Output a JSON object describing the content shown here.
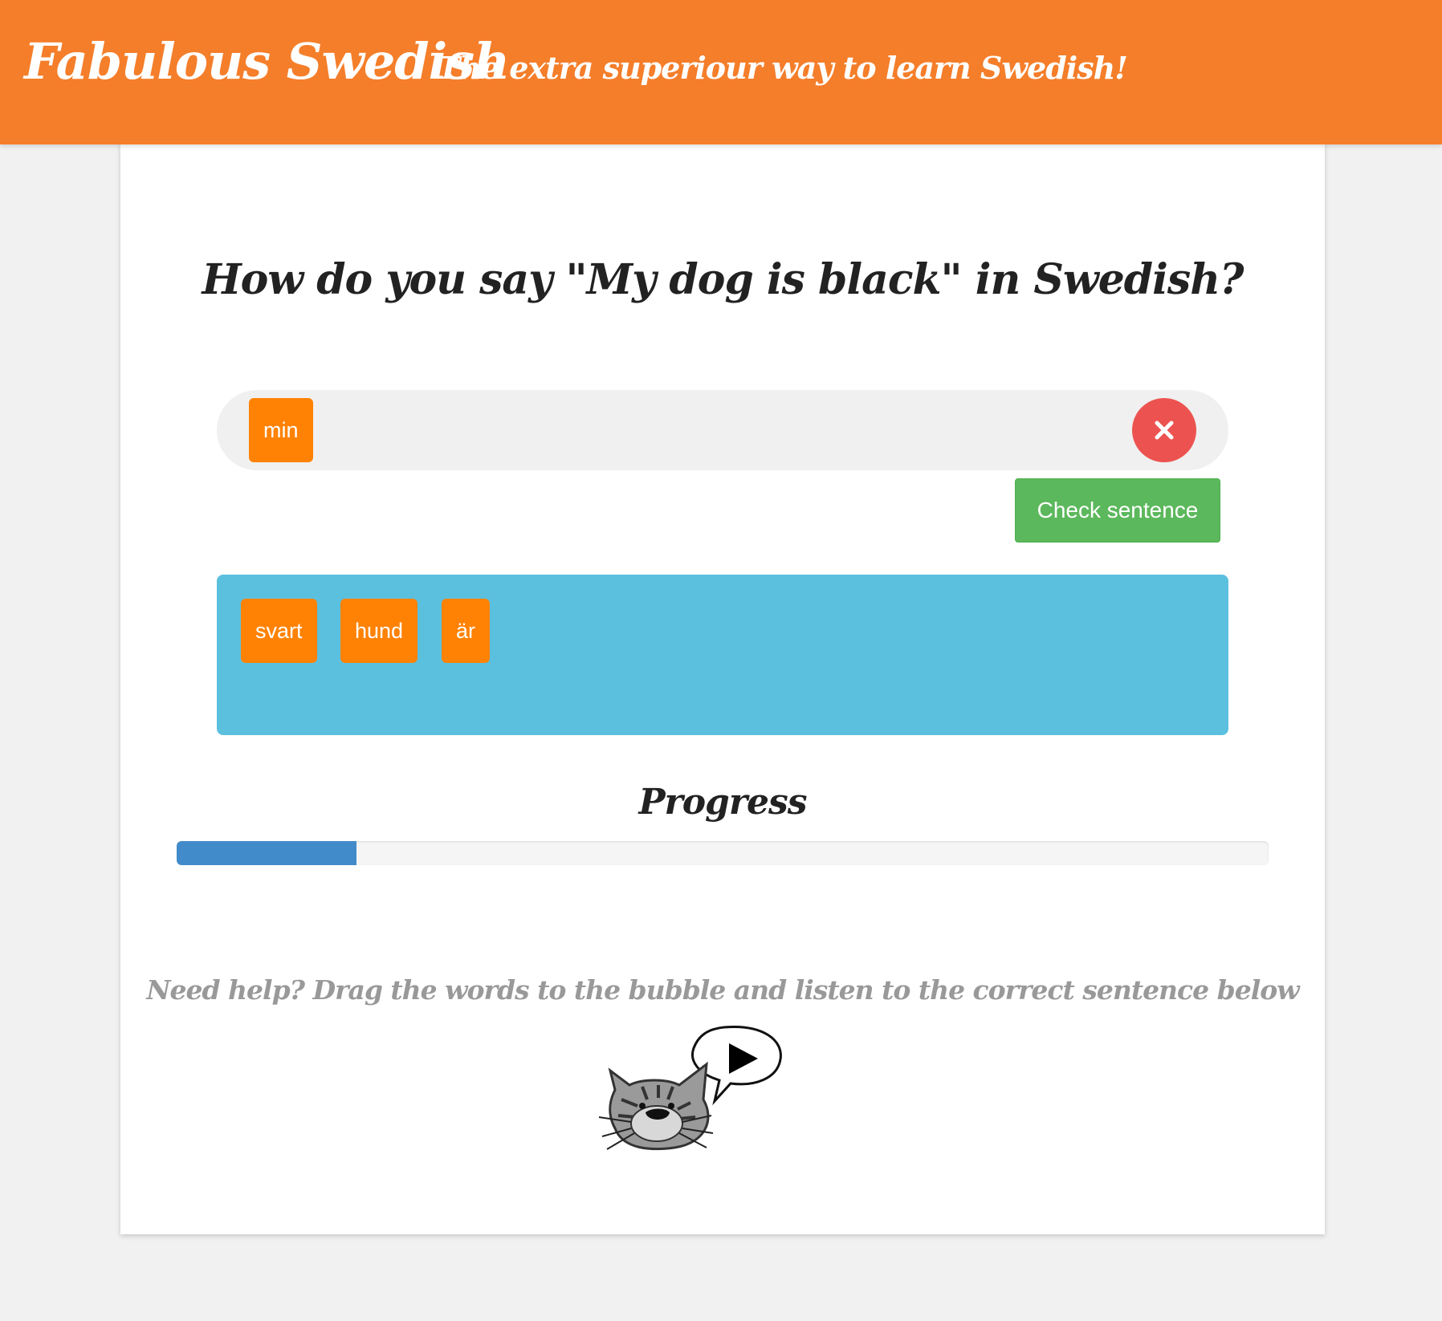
{
  "header": {
    "brand": "Fabulous Swedish",
    "tagline": "The extra superiour way to learn Swedish!"
  },
  "question": "How do you say \"My dog is black\" in Swedish?",
  "answer": {
    "words": [
      "min"
    ]
  },
  "check_button_label": "Check sentence",
  "word_bank": {
    "words": [
      "svart",
      "hund",
      "är"
    ]
  },
  "progress": {
    "label": "Progress",
    "fraction": 0.165
  },
  "help_text": "Need help? Drag the words to the bubble and listen to the correct sentence below",
  "colors": {
    "header": "#f57e2a",
    "word_tile": "#ff8205",
    "word_bank": "#5bc0de",
    "check_button": "#5cb85c",
    "clear_button": "#ec5350",
    "progress_fill": "#428bca"
  },
  "icons": {
    "clear": "close-icon",
    "audio": "cat-speech-play-icon"
  }
}
